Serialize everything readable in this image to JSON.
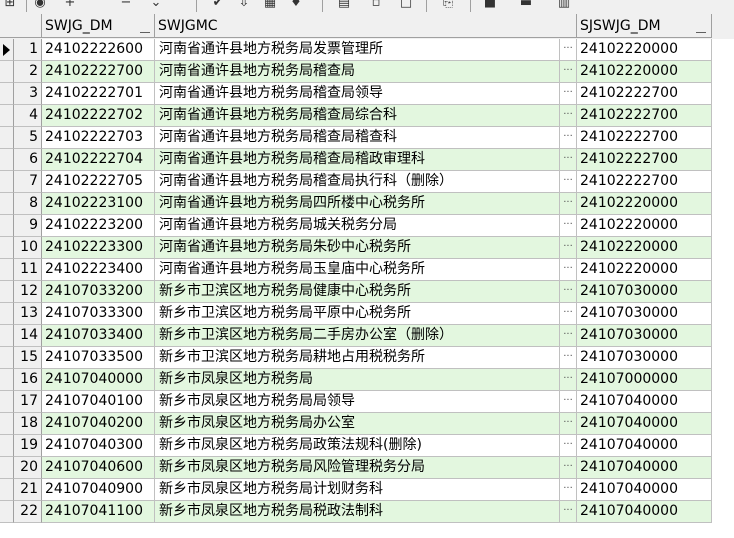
{
  "toolbar": {
    "buttons": [
      "grid-icon",
      "refresh-icon",
      "add-icon",
      "delete-icon",
      "confirm-icon",
      "cancel-icon",
      "save-icon",
      "filter-icon",
      "copy-icon",
      "paste-icon",
      "link-icon",
      "export-icon",
      "database-icon",
      "chart-icon"
    ]
  },
  "grid": {
    "columns": [
      "SWJG_DM",
      "SWJGMC",
      "SJSWJG_DM"
    ],
    "row_colors": {
      "even": "#e3f7df",
      "odd": "#ffffff"
    },
    "rows": [
      {
        "n": "1",
        "dm": "24102222600",
        "mc": "河南省通许县地方税务局发票管理所",
        "sj": "24102220000"
      },
      {
        "n": "2",
        "dm": "24102222700",
        "mc": "河南省通许县地方税务局稽查局",
        "sj": "24102220000"
      },
      {
        "n": "3",
        "dm": "24102222701",
        "mc": "河南省通许县地方税务局稽查局领导",
        "sj": "24102222700"
      },
      {
        "n": "4",
        "dm": "24102222702",
        "mc": "河南省通许县地方税务局稽查局综合科",
        "sj": "24102222700"
      },
      {
        "n": "5",
        "dm": "24102222703",
        "mc": "河南省通许县地方税务局稽查局稽查科",
        "sj": "24102222700"
      },
      {
        "n": "6",
        "dm": "24102222704",
        "mc": "河南省通许县地方税务局稽查局稽政审理科",
        "sj": "24102222700"
      },
      {
        "n": "7",
        "dm": "24102222705",
        "mc": "河南省通许县地方税务局稽查局执行科（删除）",
        "sj": "24102222700"
      },
      {
        "n": "8",
        "dm": "24102223100",
        "mc": "河南省通许县地方税务局四所楼中心税务所",
        "sj": "24102220000"
      },
      {
        "n": "9",
        "dm": "24102223200",
        "mc": "河南省通许县地方税务局城关税务分局",
        "sj": "24102220000"
      },
      {
        "n": "10",
        "dm": "24102223300",
        "mc": "河南省通许县地方税务局朱砂中心税务所",
        "sj": "24102220000"
      },
      {
        "n": "11",
        "dm": "24102223400",
        "mc": "河南省通许县地方税务局玉皇庙中心税务所",
        "sj": "24102220000"
      },
      {
        "n": "12",
        "dm": "24107033200",
        "mc": "新乡市卫滨区地方税务局健康中心税务所",
        "sj": "24107030000"
      },
      {
        "n": "13",
        "dm": "24107033300",
        "mc": "新乡市卫滨区地方税务局平原中心税务所",
        "sj": "24107030000"
      },
      {
        "n": "14",
        "dm": "24107033400",
        "mc": "新乡市卫滨区地方税务局二手房办公室（删除）",
        "sj": "24107030000"
      },
      {
        "n": "15",
        "dm": "24107033500",
        "mc": "新乡市卫滨区地方税务局耕地占用税税务所",
        "sj": "24107030000"
      },
      {
        "n": "16",
        "dm": "24107040000",
        "mc": "新乡市凤泉区地方税务局",
        "sj": "24107000000"
      },
      {
        "n": "17",
        "dm": "24107040100",
        "mc": "新乡市凤泉区地方税务局局领导",
        "sj": "24107040000"
      },
      {
        "n": "18",
        "dm": "24107040200",
        "mc": "新乡市凤泉区地方税务局办公室",
        "sj": "24107040000"
      },
      {
        "n": "19",
        "dm": "24107040300",
        "mc": "新乡市凤泉区地方税务局政策法规科(删除)",
        "sj": "24107040000"
      },
      {
        "n": "20",
        "dm": "24107040600",
        "mc": "新乡市凤泉区地方税务局风险管理税务分局",
        "sj": "24107040000"
      },
      {
        "n": "21",
        "dm": "24107040900",
        "mc": "新乡市凤泉区地方税务局计划财务科",
        "sj": "24107040000"
      },
      {
        "n": "22",
        "dm": "24107041100",
        "mc": "新乡市凤泉区地方税务局税政法制科",
        "sj": "24107040000"
      }
    ]
  }
}
